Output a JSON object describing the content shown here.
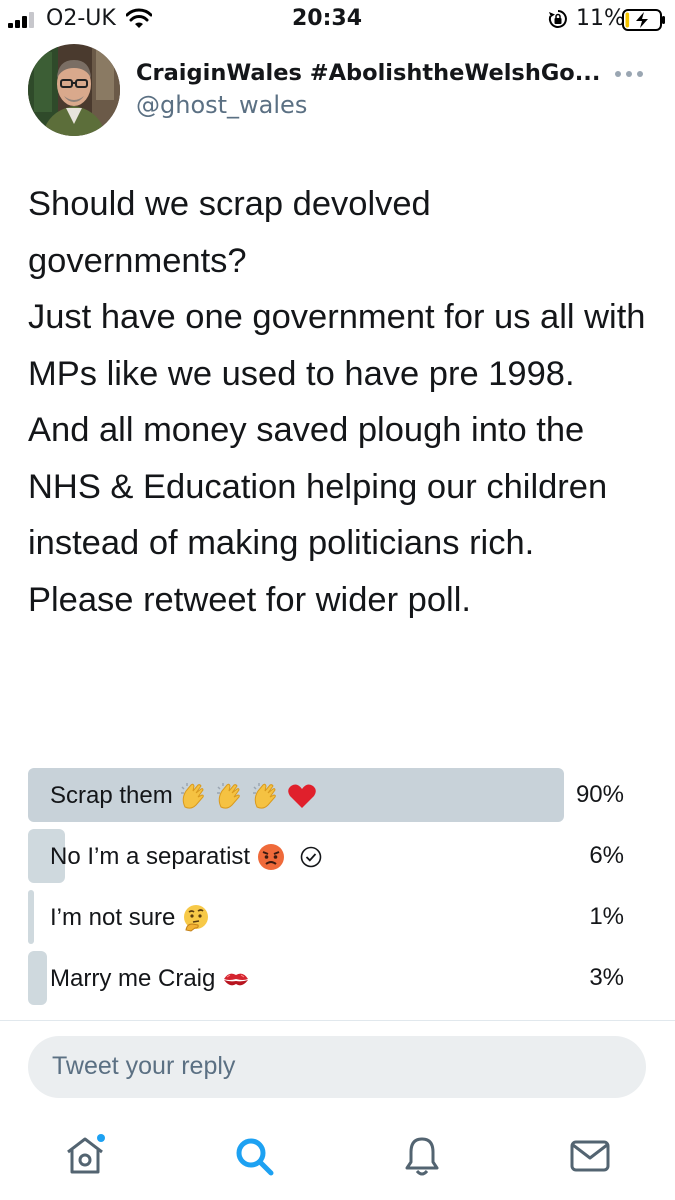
{
  "status_bar": {
    "carrier": "O2-UK",
    "time": "20:34",
    "battery_percent": "11%",
    "battery_level": 0.11,
    "signal_bars": 3
  },
  "tweet": {
    "display_name": "CraiginWales #AbolishtheWelshGo...",
    "handle": "@ghost_wales",
    "text_lines": [
      "Should we scrap devolved governments?",
      "Just have one government for us all with MPs like we used to have pre 1998.",
      "And all money saved plough into the NHS & Education helping our children instead of making politicians rich.",
      "Please retweet for wider poll."
    ]
  },
  "poll": {
    "options": [
      {
        "label": "Scrap them",
        "emoji": [
          "clapping-hands",
          "clapping-hands",
          "clapping-hands",
          "red-heart"
        ],
        "percent": "90%",
        "value": 90,
        "winner": true
      },
      {
        "label": "No I’m a separatist",
        "emoji": [
          "angry-face"
        ],
        "percent": "6%",
        "value": 6,
        "voted": true
      },
      {
        "label": "I’m not sure",
        "emoji": [
          "thinking-face"
        ],
        "percent": "1%",
        "value": 1
      },
      {
        "label": "Marry me Craig",
        "emoji": [
          "kiss-mark"
        ],
        "percent": "3%",
        "value": 3
      }
    ]
  },
  "reply": {
    "placeholder": "Tweet your reply"
  },
  "nav": {
    "items": [
      "home-icon",
      "search-icon",
      "notifications-icon",
      "messages-icon"
    ],
    "accent": "#1da1f2"
  },
  "colors": {
    "accent": "#1da1f2",
    "secondary_text": "#5b7083",
    "poll_bar": "#cfd9de"
  }
}
